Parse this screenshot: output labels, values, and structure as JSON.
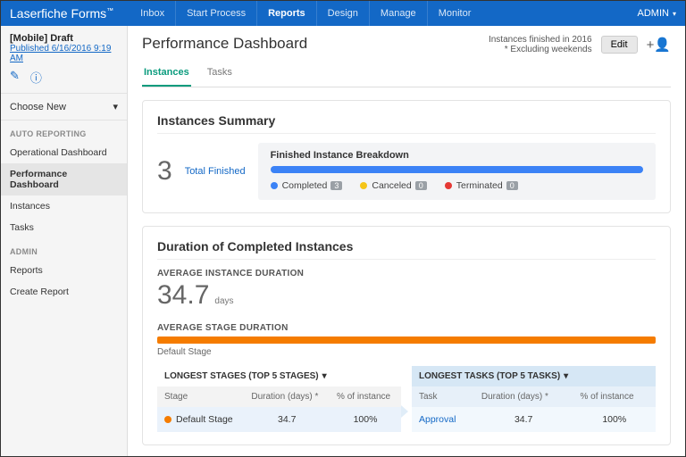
{
  "brand": "Laserfiche Forms",
  "topnav": {
    "inbox": "Inbox",
    "start": "Start Process",
    "reports": "Reports",
    "design": "Design",
    "manage": "Manage",
    "monitor": "Monitor"
  },
  "user": "ADMIN",
  "sidebar": {
    "draft_title": "[Mobile] Draft",
    "draft_link": "Published 6/16/2016 9:19 AM",
    "choose": "Choose New",
    "group_auto": "AUTO REPORTING",
    "items_auto": [
      "Operational Dashboard",
      "Performance Dashboard",
      "Instances",
      "Tasks"
    ],
    "group_admin": "ADMIN",
    "items_admin": [
      "Reports",
      "Create Report"
    ]
  },
  "page": {
    "title": "Performance Dashboard",
    "note1": "Instances finished in 2016",
    "note2": "* Excluding weekends",
    "edit": "Edit",
    "tab_instances": "Instances",
    "tab_tasks": "Tasks"
  },
  "summary": {
    "title": "Instances Summary",
    "count": "3",
    "total_finished": "Total Finished",
    "bk_title": "Finished Instance Breakdown",
    "completed_label": "Completed",
    "completed_n": "3",
    "canceled_label": "Canceled",
    "canceled_n": "0",
    "terminated_label": "Terminated",
    "terminated_n": "0"
  },
  "duration": {
    "title": "Duration of Completed Instances",
    "avg_inst_label": "AVERAGE INSTANCE DURATION",
    "avg_inst_val": "34.7",
    "avg_inst_unit": "days",
    "avg_stage_label": "AVERAGE STAGE DURATION",
    "default_stage": "Default Stage",
    "stages_head": "LONGEST STAGES (TOP 5 STAGES)",
    "tasks_head": "LONGEST TASKS (TOP 5 TASKS)",
    "col_stage": "Stage",
    "col_task": "Task",
    "col_dur": "Duration (days) *",
    "col_pct": "% of instance",
    "row_stage_name": "Default Stage",
    "row_stage_dur": "34.7",
    "row_stage_pct": "100%",
    "row_task_name": "Approval",
    "row_task_dur": "34.7",
    "row_task_pct": "100%"
  }
}
